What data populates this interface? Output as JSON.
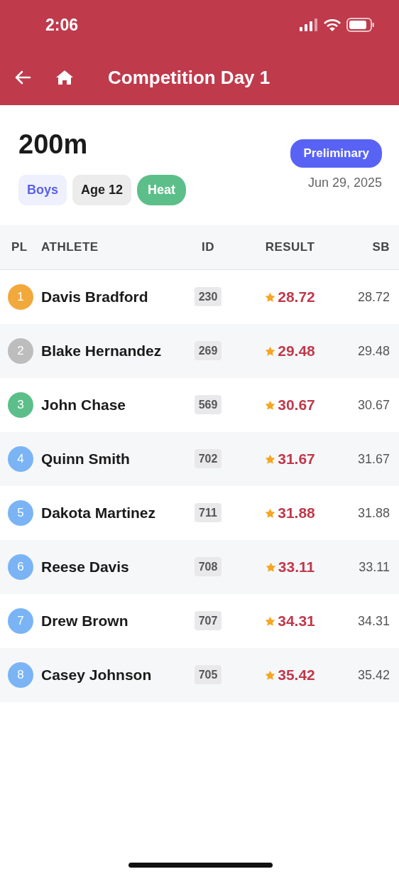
{
  "status_bar": {
    "time": "2:06"
  },
  "header": {
    "title": "Competition Day 1"
  },
  "event": {
    "name": "200m",
    "status": "Preliminary",
    "date": "Jun 29, 2025",
    "tags": [
      {
        "label": "Boys",
        "kind": "soft"
      },
      {
        "label": "Age 12",
        "kind": "neutral"
      },
      {
        "label": "Heat",
        "kind": "solid"
      }
    ]
  },
  "table": {
    "columns": [
      "PL",
      "ATHLETE",
      "ID",
      "RESULT",
      "SB"
    ],
    "rows": [
      {
        "place": "1",
        "color": "#f2a93b",
        "athlete": "Davis Bradford",
        "id": "230",
        "best": true,
        "result": "28.72",
        "sb": "28.72"
      },
      {
        "place": "2",
        "color": "#bdbdbd",
        "athlete": "Blake Hernandez",
        "id": "269",
        "best": true,
        "result": "29.48",
        "sb": "29.48"
      },
      {
        "place": "3",
        "color": "#5cbf8a",
        "athlete": "John Chase",
        "id": "569",
        "best": true,
        "result": "30.67",
        "sb": "30.67"
      },
      {
        "place": "4",
        "color": "#7ab4f5",
        "athlete": "Quinn Smith",
        "id": "702",
        "best": true,
        "result": "31.67",
        "sb": "31.67"
      },
      {
        "place": "5",
        "color": "#7ab4f5",
        "athlete": "Dakota Martinez",
        "id": "711",
        "best": true,
        "result": "31.88",
        "sb": "31.88"
      },
      {
        "place": "6",
        "color": "#7ab4f5",
        "athlete": "Reese Davis",
        "id": "708",
        "best": true,
        "result": "33.11",
        "sb": "33.11"
      },
      {
        "place": "7",
        "color": "#7ab4f5",
        "athlete": "Drew Brown",
        "id": "707",
        "best": true,
        "result": "34.31",
        "sb": "34.31"
      },
      {
        "place": "8",
        "color": "#7ab4f5",
        "athlete": "Casey Johnson",
        "id": "705",
        "best": true,
        "result": "35.42",
        "sb": "35.42"
      }
    ]
  }
}
